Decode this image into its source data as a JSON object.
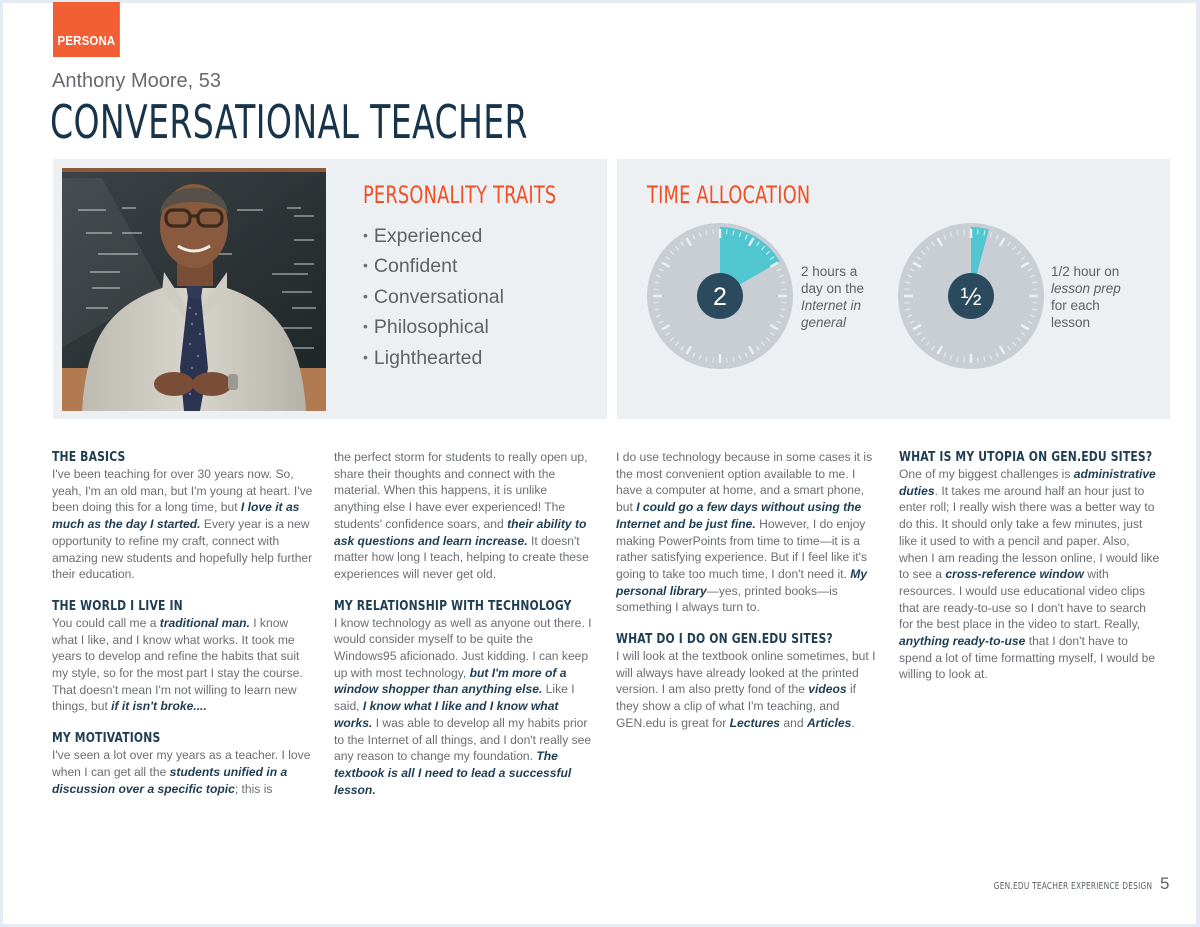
{
  "header": {
    "tag": "PERSONA",
    "name": "Anthony Moore, 53",
    "title": "CONVERSATIONAL TEACHER"
  },
  "photo": {
    "alt": "Portrait of a smiling teacher with glasses in front of a chalkboard"
  },
  "personality": {
    "heading": "PERSONALITY TRAITS",
    "traits": [
      "Experienced",
      "Confident",
      "Conversational",
      "Philosophical",
      "Lighthearted"
    ]
  },
  "time_allocation": {
    "heading": "TIME ALLOCATION",
    "accent_color": "#4fc6d0",
    "gauges": [
      {
        "center_label": "2",
        "hours": 2,
        "scale_hours": 12,
        "caption_line1": "2 hours a",
        "caption_line2": "day on the",
        "caption_line3": "Internet in",
        "caption_line4": "general"
      },
      {
        "center_label": "½",
        "hours": 0.5,
        "scale_hours": 12,
        "caption_line1": "1/2 hour on",
        "caption_line2": "lesson prep",
        "caption_line3": "for each",
        "caption_line4": "lesson"
      }
    ]
  },
  "sections": {
    "basics": {
      "heading": "THE BASICS",
      "t1": "I've been teaching for over 30 years now. So, yeah, I'm an old man, but I'm young at heart. I've been doing this for a long time, but ",
      "h1": "I love it as much as the day I started.",
      "t2": " Every year is a new opportunity to refine my craft, connect with amazing new students and hopefully help further their education."
    },
    "world": {
      "heading": "THE WORLD I LIVE IN",
      "t1": "You could call me a ",
      "h1": "traditional man.",
      "t2": " I know what I like, and I know what works. It took me years to develop and refine the habits that suit my style, so for the most part I stay the course. That doesn't mean I'm not willing to learn new things, but ",
      "h2": "if it isn't broke...."
    },
    "motivations": {
      "heading": "MY MOTIVATIONS",
      "t1": "I've seen a lot over my years as a teacher. I love when I can get all the ",
      "h1": "students unified in a discussion over a specific topic",
      "t2": "; this is the perfect storm for students to really open up, share their thoughts and connect with the material. When this happens, it is unlike anything else I have ever experienced! The students' confidence soars, and ",
      "h2": "their ability to ask questions and learn increase.",
      "t3": " It doesn't matter how long I teach, helping to create these experiences will never get old."
    },
    "technology": {
      "heading": "MY RELATIONSHIP WITH TECHNOLOGY",
      "t1": "I know technology as well as anyone out there. I would consider myself to be quite the Windows95 aficionado. Just kidding. I can keep up with most technology, ",
      "h1": "but I'm more of a window shopper than anything else.",
      "t2": " Like I said, ",
      "h2": "I know what I like and I know what works.",
      "t3": " I was able to develop all my habits prior to the Internet of all things, and I don't really see any reason to change my foundation. ",
      "h3": "The textbook is all I need to lead a successful lesson.",
      "t4": "I do use technology because in some cases it is the most convenient option available to me. I have a computer at home, and a smart phone, but ",
      "h4": "I could go a few days without using the Internet and be just fine.",
      "t5": " However, I do enjoy making PowerPoints from time to time—it is a rather satisfying experience. But if I feel like it's going to take too much time, I don't need it. ",
      "h5": "My personal library",
      "t6": "—yes, printed books—is something I always turn to."
    },
    "gen_edu_do": {
      "heading": "WHAT DO I DO ON GEN.EDU SITES?",
      "t1": "I will look at the textbook online sometimes, but I will always have already looked at the printed version. I am also pretty fond of the ",
      "h1": "videos",
      "t2": " if they show a clip of what I'm teaching, and GEN.edu is great for ",
      "h2": "Lectures",
      "t3": " and ",
      "h3": "Articles",
      "t4": "."
    },
    "utopia": {
      "heading": "WHAT IS MY UTOPIA ON GEN.EDU SITES?",
      "t1": "One of my biggest challenges is ",
      "h1": "administrative duties",
      "t2": ". It takes me around half an hour just to enter roll; I really wish there was a better way to do this. It should only take a few minutes, just like it used to with a pencil and paper. Also, when I am reading the lesson online, I would like to see a ",
      "h2": "cross-reference window",
      "t3": " with resources. I would use educational video clips that are ready-to-use so I don't have to search for the best place in the video to start. Really, ",
      "h3": "anything ready-to-use",
      "t4": " that I don't have to spend a lot of time formatting myself, I would be willing to look at."
    }
  },
  "footer": {
    "label": "GEN.EDU TEACHER EXPERIENCE DESIGN",
    "page_number": "5"
  }
}
